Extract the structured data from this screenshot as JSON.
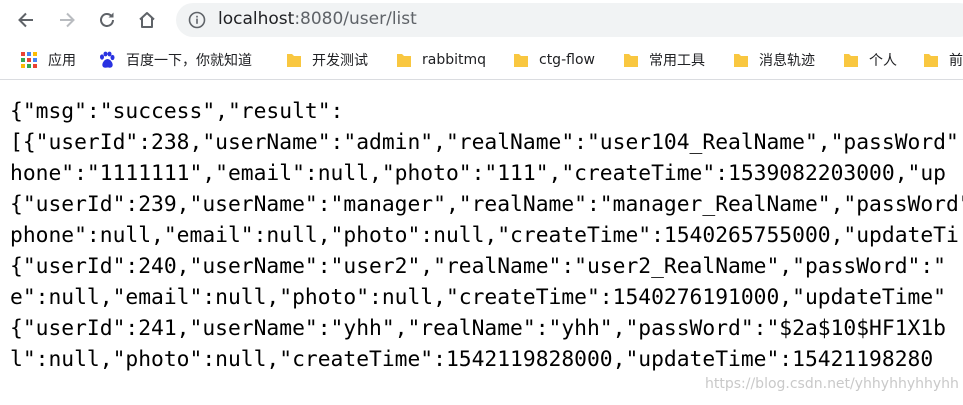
{
  "browser": {
    "url_host": "localhost",
    "url_rest": ":8080/user/list",
    "icons": {
      "back": "back-arrow-icon",
      "forward": "forward-arrow-icon",
      "reload": "reload-icon",
      "home": "home-icon",
      "info": "info-icon"
    }
  },
  "bookmarks": [
    {
      "label": "应用",
      "icon": "apps-grid-icon"
    },
    {
      "label": "百度一下，你就知道",
      "icon": "baidu-paw-icon"
    },
    {
      "label": "开发测试",
      "icon": "folder-icon"
    },
    {
      "label": "rabbitmq",
      "icon": "folder-icon"
    },
    {
      "label": "ctg-flow",
      "icon": "folder-icon"
    },
    {
      "label": "常用工具",
      "icon": "folder-icon"
    },
    {
      "label": "消息轨迹",
      "icon": "folder-icon"
    },
    {
      "label": "个人",
      "icon": "folder-icon"
    },
    {
      "label": "前",
      "icon": "folder-icon"
    }
  ],
  "content": {
    "lines": [
      "{\"msg\":\"success\",\"result\":",
      "[{\"userId\":238,\"userName\":\"admin\",\"realName\":\"user104_RealName\",\"passWord\"",
      "hone\":\"1111111\",\"email\":null,\"photo\":\"111\",\"createTime\":1539082203000,\"up",
      "{\"userId\":239,\"userName\":\"manager\",\"realName\":\"manager_RealName\",\"passWord\"",
      "phone\":null,\"email\":null,\"photo\":null,\"createTime\":1540265755000,\"updateTi",
      "{\"userId\":240,\"userName\":\"user2\",\"realName\":\"user2_RealName\",\"passWord\":\"",
      "e\":null,\"email\":null,\"photo\":null,\"createTime\":1540276191000,\"updateTime\"",
      "{\"userId\":241,\"userName\":\"yhh\",\"realName\":\"yhh\",\"passWord\":\"$2a$10$HF1X1b",
      "l\":null,\"photo\":null,\"createTime\":1542119828000,\"updateTime\":15421198280"
    ]
  },
  "watermark": "https://blog.csdn.net/yhhyhhyhhyhh",
  "colors": {
    "omnibox_bg": "#f1f3f4",
    "folder": "#f9c740",
    "icon_gray": "#5f6368"
  }
}
